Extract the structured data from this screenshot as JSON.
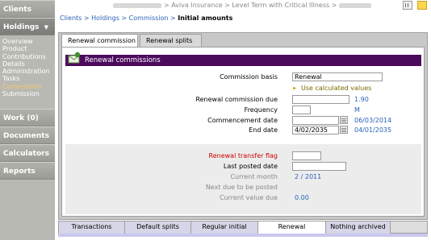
{
  "sidebar": {
    "clients": "Clients",
    "holdings": "Holdings",
    "holdings_items": [
      "Overview",
      "Product",
      "Contributions",
      "Details",
      "Administration",
      "Tasks",
      "Commission",
      "Submission"
    ],
    "active_item": "Commission",
    "work": "Work (0)",
    "documents": "Documents",
    "calculators": "Calculators",
    "reports": "Reports"
  },
  "topbar": {
    "trail": "> Aviva Insurance > Level Term with Critical Illness >"
  },
  "breadcrumb": {
    "items": [
      "Clients",
      "Holdings",
      "Commission"
    ],
    "current": "Initial amounts",
    "separator": ">"
  },
  "tabs": {
    "renewal_commission": "Renewal commission",
    "renewal_splits": "Renewal splits"
  },
  "section": {
    "title": "Renewal commissions"
  },
  "form": {
    "commission_basis_label": "Commission basis",
    "commission_basis_value": "Renewal",
    "use_calculated": "Use calculated values",
    "renewal_commission_due_label": "Renewal commission due",
    "renewal_commission_due_value": "",
    "renewal_commission_due_calc": "1.90",
    "frequency_label": "Frequency",
    "frequency_value": "",
    "frequency_calc": "M",
    "commencement_label": "Commencement date",
    "commencement_value": "",
    "commencement_calc": "06/03/2014",
    "end_label": "End date",
    "end_value": "4/02/2035",
    "end_calc": "04/01/2035",
    "transfer_flag_label": "Renewal transfer flag",
    "last_posted_label": "Last posted date",
    "current_month_label": "Current month",
    "current_month_value": "2 / 2011",
    "next_due_label": "Next due to be posted",
    "current_value_label": "Current value due",
    "current_value_value": "0.00"
  },
  "bottom_tabs": [
    "Transactions",
    "Default splits",
    "Regular initial",
    "Renewal",
    "Nothing archived"
  ],
  "active_bottom_tab": "Renewal",
  "colors": {
    "title_bar": "#4c0a5d",
    "link": "#2a62b8",
    "active_nav": "#f6c76b",
    "required_label": "#cc0000"
  }
}
